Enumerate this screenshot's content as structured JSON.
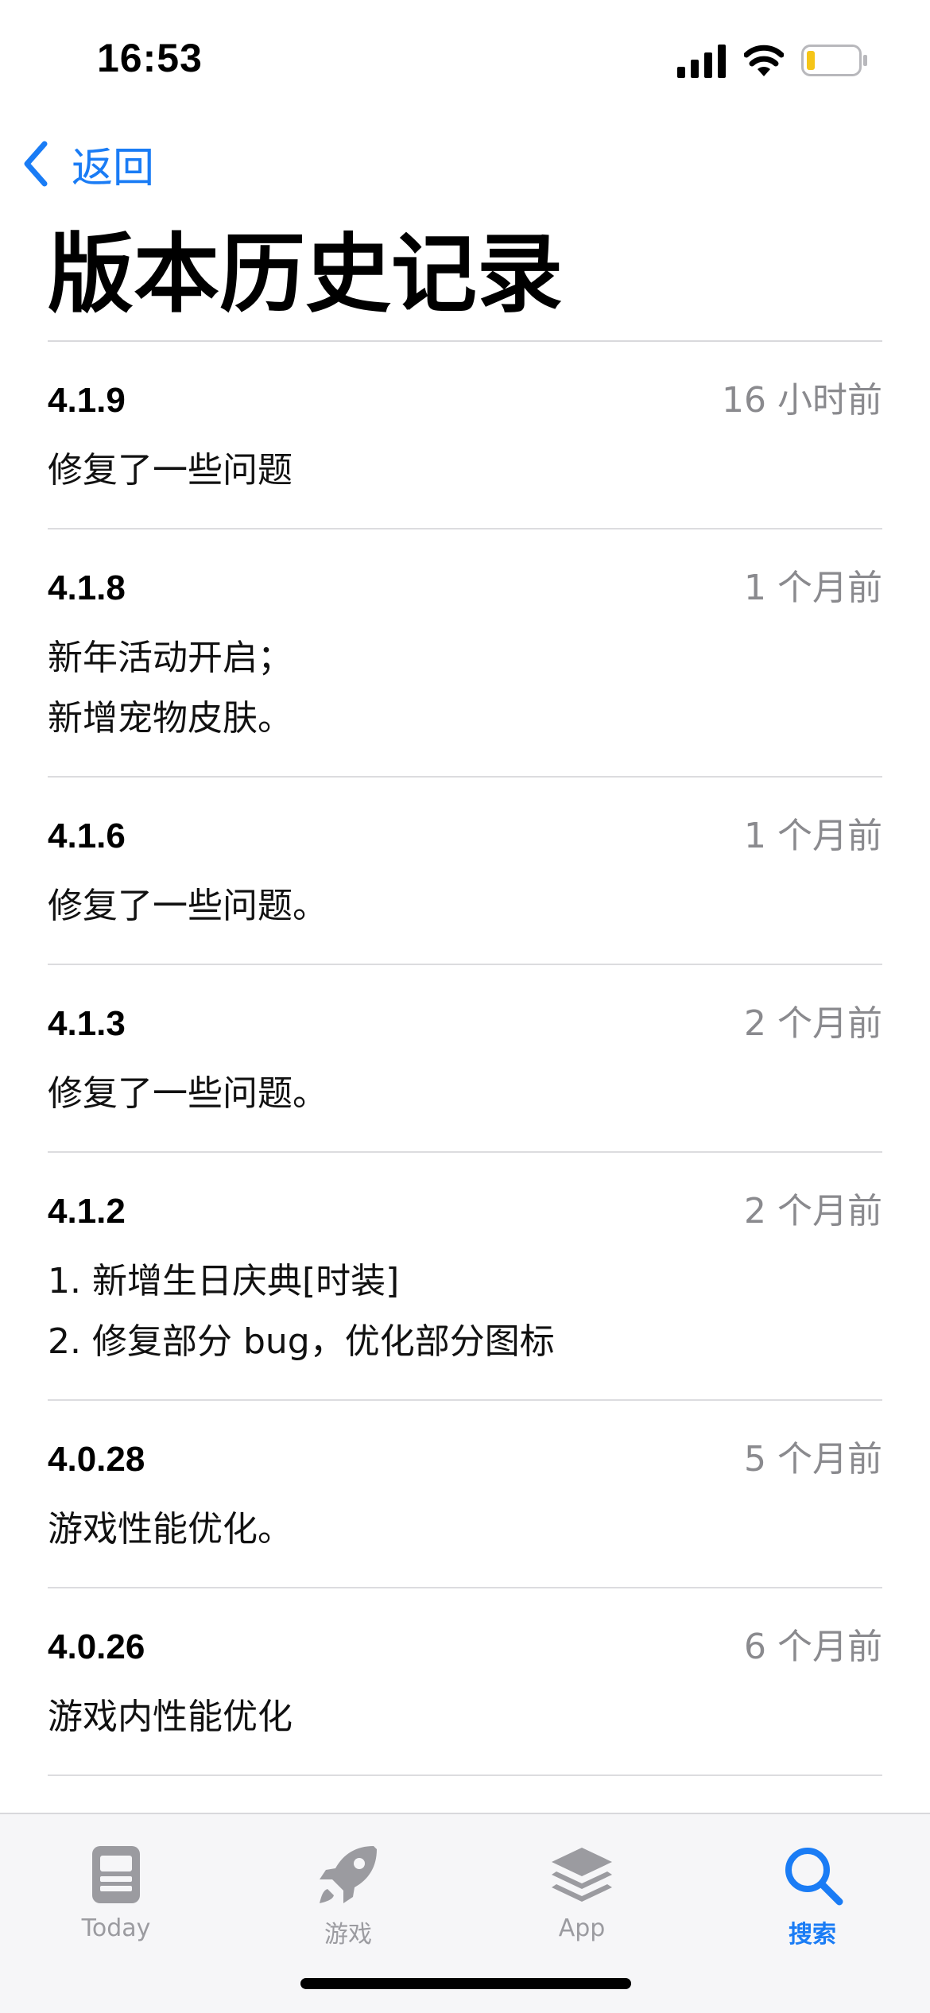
{
  "status_bar": {
    "time": "16:53"
  },
  "nav": {
    "back_label": "返回"
  },
  "page": {
    "title": "版本历史记录"
  },
  "versions": [
    {
      "version": "4.1.9",
      "date": "16 小时前",
      "notes": [
        "修复了一些问题"
      ]
    },
    {
      "version": "4.1.8",
      "date": "1 个月前",
      "notes": [
        "新年活动开启；",
        "新增宠物皮肤。"
      ]
    },
    {
      "version": "4.1.6",
      "date": "1 个月前",
      "notes": [
        "修复了一些问题。"
      ]
    },
    {
      "version": "4.1.3",
      "date": "2 个月前",
      "notes": [
        "修复了一些问题。"
      ]
    },
    {
      "version": "4.1.2",
      "date": "2 个月前",
      "notes": [
        "1. 新增生日庆典[时装]",
        "2. 修复部分 bug，优化部分图标"
      ]
    },
    {
      "version": "4.0.28",
      "date": "5 个月前",
      "notes": [
        "游戏性能优化。"
      ]
    },
    {
      "version": "4.0.26",
      "date": "6 个月前",
      "notes": [
        "游戏内性能优化"
      ]
    }
  ],
  "tab_bar": {
    "tabs": [
      {
        "label": "Today",
        "icon": "today-icon",
        "active": false
      },
      {
        "label": "游戏",
        "icon": "rocket-icon",
        "active": false
      },
      {
        "label": "App",
        "icon": "layers-icon",
        "active": false
      },
      {
        "label": "搜索",
        "icon": "search-icon",
        "active": true
      }
    ]
  },
  "colors": {
    "accent": "#1a7cf5",
    "secondary_text": "#8a8a8e",
    "tab_inactive": "#9b9ba0",
    "battery_level": "#f5c518"
  }
}
